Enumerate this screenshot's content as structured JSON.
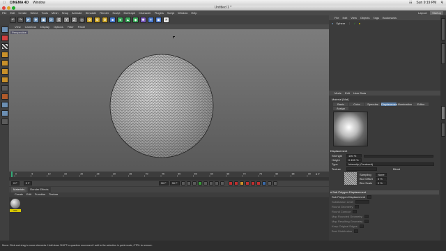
{
  "mac_menu": {
    "app": "CINEMA 4D",
    "window": "Window",
    "clock": "Sun 9:19 PM"
  },
  "window_title": "Untitled 1 *",
  "menubar": [
    "File",
    "Edit",
    "Create",
    "Select",
    "Tools",
    "Mesh",
    "Snap",
    "Animate",
    "Simulate",
    "Render",
    "Sculpt",
    "MoGraph",
    "Character",
    "Plugins",
    "Script",
    "Window",
    "Help"
  ],
  "layout": {
    "label": "Layout:",
    "value": "Startup"
  },
  "viewport": {
    "menu": [
      "View",
      "Cameras",
      "Display",
      "Options",
      "Filter",
      "Panel"
    ],
    "label": "Perspective"
  },
  "timeline": {
    "ticks": [
      "0",
      "5",
      "10",
      "15",
      "20",
      "25",
      "30",
      "35",
      "40",
      "45",
      "50",
      "55",
      "60",
      "65",
      "70",
      "75",
      "80",
      "85",
      "90"
    ],
    "end_frame": "0 F"
  },
  "playback": {
    "start": "0 F",
    "current": "0 F",
    "end": "90 F",
    "end2": "90 F"
  },
  "materials": {
    "tabs": [
      "Materials",
      "Render Effects"
    ],
    "menu": [
      "Create",
      "Edit",
      "Function",
      "Texture"
    ],
    "mat_name": "Mat"
  },
  "objects": {
    "menu": [
      "File",
      "Edit",
      "View",
      "Objects",
      "Tags",
      "Bookmarks"
    ],
    "item": "Sphere"
  },
  "attributes": {
    "menu": [
      "Mode",
      "Edit",
      "User Data"
    ],
    "title": "Material [Mat]",
    "tabs": [
      "Basic",
      "Color",
      "Specular",
      "Displacement",
      "Illumination",
      "Editor",
      "Assign"
    ],
    "active_tab": "Displacement",
    "section": "Displacement",
    "strength": {
      "label": "Strength",
      "value": "100 %"
    },
    "height": {
      "label": "Height",
      "value": "0.159 %"
    },
    "type": {
      "label": "Type",
      "value": "Intensity (Centered)"
    },
    "texture": {
      "label": "Texture",
      "blur_label": "Blend",
      "sampling_label": "Sampling",
      "sampling_value": "None",
      "blur_offset_label": "Blur Offset",
      "blur_offset": "0 %",
      "blur_scale_label": "Blur Scale",
      "blur_scale": "0 %"
    },
    "subpoly_title": "Sub Polygon Displacement",
    "subpoly_rows": [
      "Sub Polygon Displacement",
      "Subdivision Level",
      "Round Geometry",
      "Round Contour",
      "Map Rounded Geometry",
      "Map Resulting Geometry",
      "Keep Original Edges",
      "Best Distribution"
    ]
  },
  "status": "Move: Click and drag to move elements. Hold down SHIFT to quantize movement / add to the selection in point mode, CTRL to remove.",
  "colors": {
    "accent": "#5b7fa8",
    "material_label": "#d8c800"
  }
}
